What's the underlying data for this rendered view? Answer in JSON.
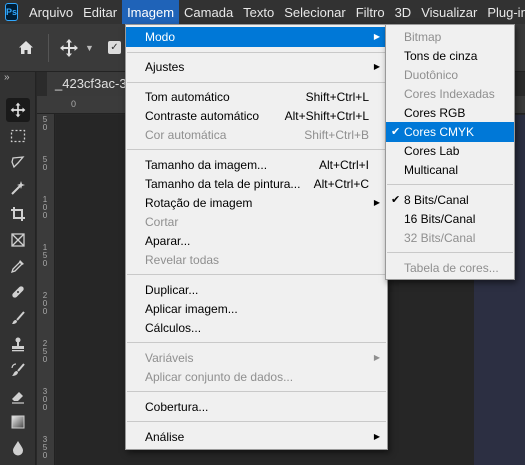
{
  "app": {
    "logo_text": "Ps"
  },
  "menubar": [
    {
      "label": "Arquivo"
    },
    {
      "label": "Editar"
    },
    {
      "label": "Imagem"
    },
    {
      "label": "Camada"
    },
    {
      "label": "Texto"
    },
    {
      "label": "Selecionar"
    },
    {
      "label": "Filtro"
    },
    {
      "label": "3D"
    },
    {
      "label": "Visualizar"
    },
    {
      "label": "Plug-ins"
    }
  ],
  "document": {
    "tab_title": "_423cf3ac-3",
    "ruler_left": [
      "5",
      "0",
      "5",
      "0",
      "1",
      "0",
      "0",
      "1",
      "5",
      "0",
      "2",
      "0",
      "0",
      "2",
      "5",
      "0",
      "3",
      "0",
      "0",
      "3",
      "5",
      "0"
    ],
    "ruler_top": [
      "0"
    ]
  },
  "imagem_menu": {
    "items": [
      {
        "label": "Modo",
        "shortcut": "",
        "submenu": true,
        "disabled": false,
        "highlighted": true
      },
      {
        "label": "Ajustes",
        "shortcut": "",
        "submenu": true,
        "disabled": false
      },
      {
        "label": "Tom automático",
        "shortcut": "Shift+Ctrl+L",
        "disabled": false
      },
      {
        "label": "Contraste automático",
        "shortcut": "Alt+Shift+Ctrl+L",
        "disabled": false
      },
      {
        "label": "Cor automática",
        "shortcut": "Shift+Ctrl+B",
        "disabled": true
      },
      {
        "label": "Tamanho da imagem...",
        "shortcut": "Alt+Ctrl+I",
        "disabled": false
      },
      {
        "label": "Tamanho da tela de pintura...",
        "shortcut": "Alt+Ctrl+C",
        "disabled": false
      },
      {
        "label": "Rotação de imagem",
        "shortcut": "",
        "submenu": true,
        "disabled": false
      },
      {
        "label": "Cortar",
        "shortcut": "",
        "disabled": true
      },
      {
        "label": "Aparar...",
        "shortcut": "",
        "disabled": false
      },
      {
        "label": "Revelar todas",
        "shortcut": "",
        "disabled": true
      },
      {
        "label": "Duplicar...",
        "shortcut": "",
        "disabled": false
      },
      {
        "label": "Aplicar imagem...",
        "shortcut": "",
        "disabled": false
      },
      {
        "label": "Cálculos...",
        "shortcut": "",
        "disabled": false
      },
      {
        "label": "Variáveis",
        "shortcut": "",
        "submenu": true,
        "disabled": true
      },
      {
        "label": "Aplicar conjunto de dados...",
        "shortcut": "",
        "disabled": true
      },
      {
        "label": "Cobertura...",
        "shortcut": "",
        "disabled": false
      },
      {
        "label": "Análise",
        "shortcut": "",
        "submenu": true,
        "disabled": false
      }
    ]
  },
  "modo_submenu": {
    "items": [
      {
        "label": "Bitmap",
        "disabled": true,
        "checked": false
      },
      {
        "label": "Tons de cinza",
        "disabled": false,
        "checked": false
      },
      {
        "label": "Duotônico",
        "disabled": true,
        "checked": false
      },
      {
        "label": "Cores Indexadas",
        "disabled": true,
        "checked": false
      },
      {
        "label": "Cores RGB",
        "disabled": false,
        "checked": false
      },
      {
        "label": "Cores CMYK",
        "disabled": false,
        "checked": true,
        "highlighted": true
      },
      {
        "label": "Cores Lab",
        "disabled": false,
        "checked": false
      },
      {
        "label": "Multicanal",
        "disabled": false,
        "checked": false
      },
      {
        "label": "8 Bits/Canal",
        "disabled": false,
        "checked": true
      },
      {
        "label": "16 Bits/Canal",
        "disabled": false,
        "checked": false
      },
      {
        "label": "32 Bits/Canal",
        "disabled": true,
        "checked": false
      },
      {
        "label": "Tabela de cores...",
        "disabled": true,
        "checked": false
      }
    ]
  },
  "colors": {
    "menu_highlight": "#0078d7",
    "menubar_active": "#1f63b8",
    "ps_blue": "#31a8ff"
  }
}
